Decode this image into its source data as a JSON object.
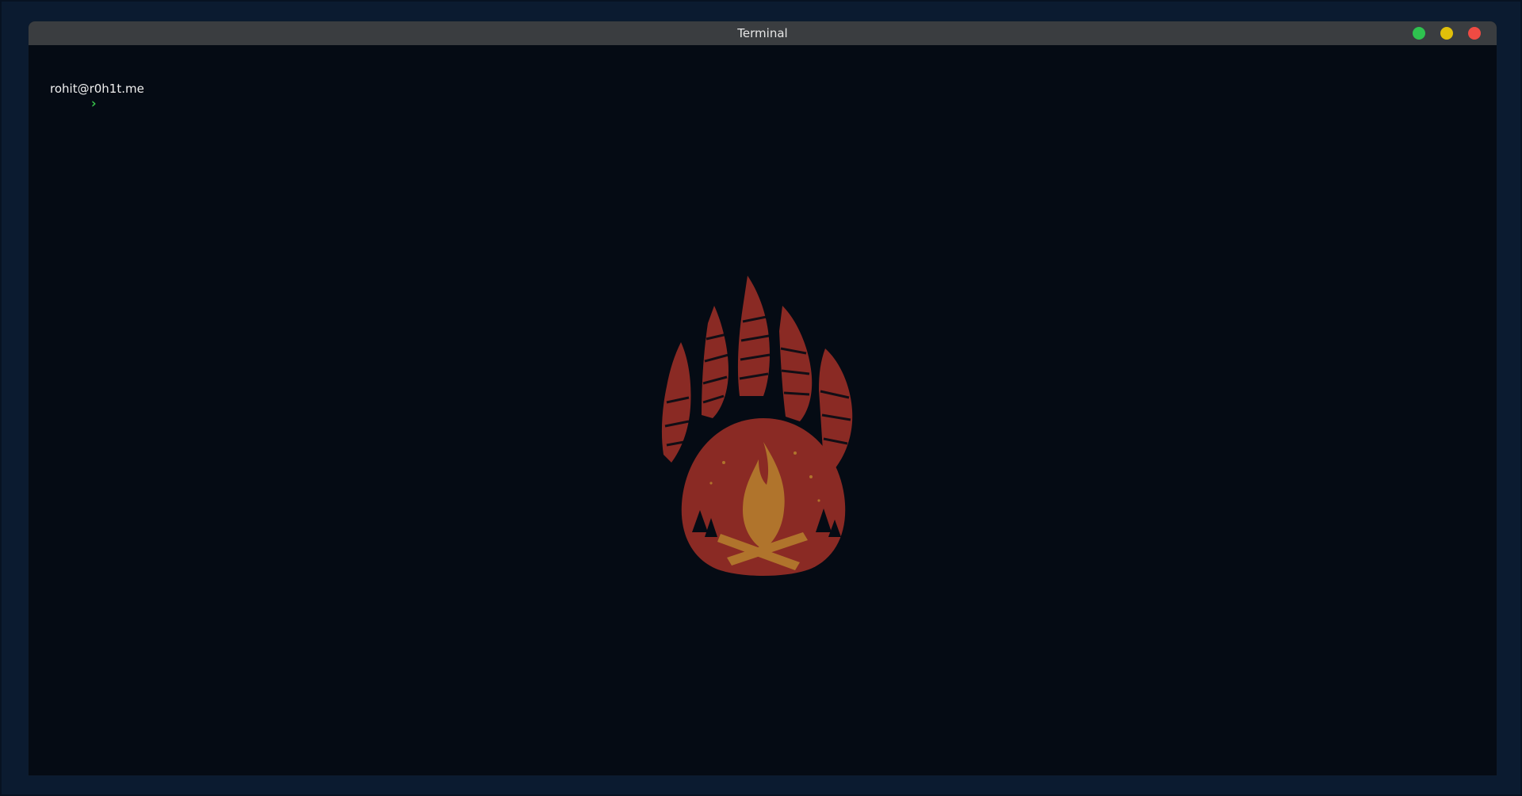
{
  "window": {
    "title": "Terminal",
    "controls": [
      {
        "name": "maximize",
        "color": "#2ec24f"
      },
      {
        "name": "minimize",
        "color": "#e1c00a"
      },
      {
        "name": "close",
        "color": "#ef4b43"
      }
    ]
  },
  "terminal": {
    "prompt_user": "rohit@r0h1t.me",
    "prompt_symbol": "›",
    "input_value": ""
  },
  "wallpaper": {
    "icon": "bear-paw-campfire-logo",
    "colors": {
      "paw": "#8a2a24",
      "fire": "#b0742c",
      "background": "#050b14"
    }
  }
}
